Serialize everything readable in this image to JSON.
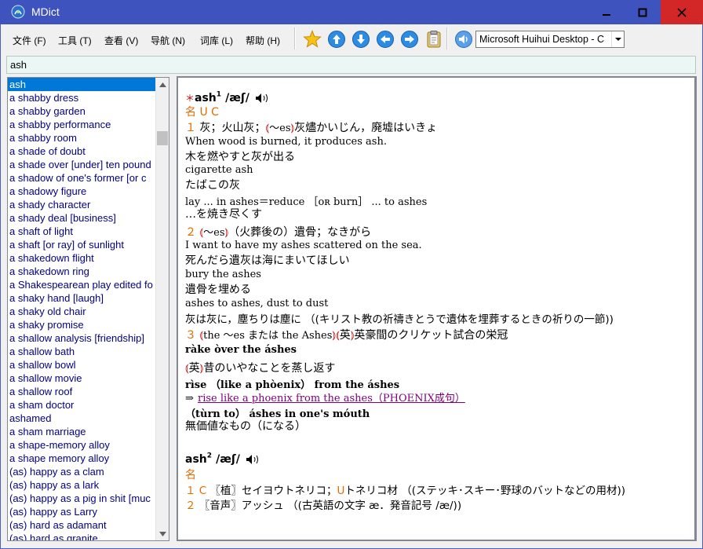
{
  "window": {
    "title": "MDict"
  },
  "menu": [
    "文件 (F)",
    "工具 (T)",
    "查看 (V)",
    "导航 (N)",
    "词库 (L)",
    "帮助 (H)"
  ],
  "toolbar": {
    "dictionary": "Microsoft Huihui Desktop - C"
  },
  "search": {
    "value": "ash"
  },
  "wordlist": {
    "items": [
      "ash",
      "a shabby dress",
      "a shabby garden",
      "a shabby performance",
      "a shabby room",
      "a shade of doubt",
      "a shade over [under] ten pound",
      "a shadow of one's former [or c",
      "a shadowy figure",
      "a shady character",
      "a shady deal [business]",
      "a shaft of light",
      "a shaft [or ray] of sunlight",
      "a shakedown flight",
      "a shakedown ring",
      "a Shakespearean play edited fo",
      "a shaky hand [laugh]",
      "a shaky old chair",
      "a shaky promise",
      "a shallow analysis [friendship]",
      "a shallow bath",
      "a shallow bowl",
      "a shallow movie",
      "a shallow roof",
      "a sham doctor",
      "ashamed",
      "a sham marriage",
      "a shape-memory alloy",
      "a shape memory alloy",
      "(as) happy as a clam",
      "(as) happy as a lark",
      "(as) happy as a pig in shit [muc",
      "(as) happy as Larry",
      "(as) hard as adamant",
      "(as) hard as granite"
    ],
    "selected": 0
  },
  "entry1": {
    "headword": "ash",
    "sup": "1",
    "pron": "/æʃ/",
    "pos_label": "名",
    "grammar": "U C",
    "s1_num": "１",
    "s1_def": "灰；火山灰；",
    "s1_tag": "〜es",
    "s1_rest": "灰燼かいじん，廃墟はいきょ",
    "ex1_en": "When wood is burned, it produces ash.",
    "ex1_jp": "木を燃やすと灰が出る",
    "ex2_en": "cigarette ash",
    "ex2_jp": "たばこの灰",
    "ex3_en": "lay ... in ashes＝reduce ［ᴏʀ burn］ ... to ashes",
    "ex3_jp": "…を焼き尽くす",
    "s2_num": "２",
    "s2_tag": "〜es",
    "s2_def": "（火葬後の）遺骨；なきがら",
    "ex4_en": "I want to have my ashes scattered on the sea.",
    "ex4_jp": "死んだら遺灰は海にまいてほしい",
    "ex5_en": "bury the ashes",
    "ex5_jp": "遺骨を埋める",
    "ex6_en": "ashes to ashes, dust to dust",
    "ex6_jp": "灰は灰に，塵ちりは塵に （(キリスト教の祈禱きとうで遺体を埋葬するときの祈りの一節))",
    "s3_num": "３",
    "s3_tag": "the 〜es または the Ashes",
    "s3_tag2": "英",
    "s3_def": "英豪間のクリケット試合の栄冠",
    "ph1": "ràke òver the áshes",
    "ph1_tag": "英",
    "ph1_def": "昔のいやなことを蒸し返す",
    "ph2": "rìse （like a phòenix） from the áshes",
    "ph2_arrow": "⇒",
    "ph2_link": "rise like a phoenix from the ashes（PHOENIX成句）",
    "ph3": "（tùrn to） áshes in one's móuth",
    "ph3_def": "無価値なもの（になる）"
  },
  "entry2": {
    "headword": "ash",
    "sup": "2",
    "pron": "/æʃ/",
    "pos_label": "名",
    "s1_num": "１",
    "s1_c": "C",
    "s1_def": "〖植〗セイヨウトネリコ；",
    "s1_u": "U",
    "s1_rest": "トネリコ材 （(ステッキ･スキー･野球のバットなどの用材))",
    "s2_num": "２",
    "s2_def": "〖音声〗アッシュ （(古英語の文字 æ．発音記号 /æ/))"
  }
}
